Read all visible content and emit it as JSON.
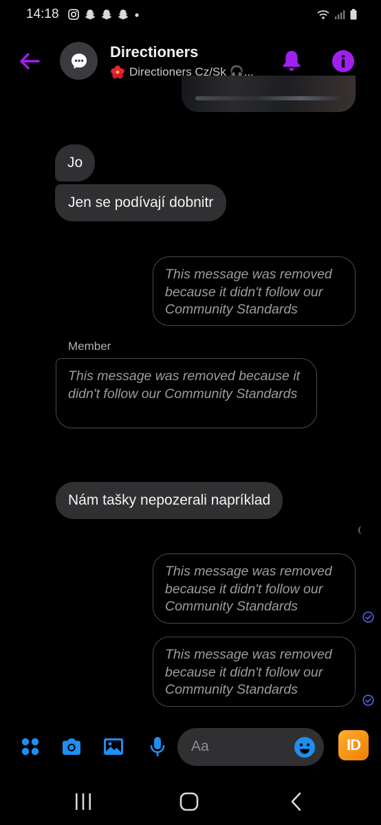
{
  "status_bar": {
    "time": "14:18"
  },
  "header": {
    "title": "Directioners",
    "subtitle": "Directioners Cz/Sk 🎧...",
    "accent_color": "#a020f0"
  },
  "messages": {
    "jo": "Jo",
    "jen": "Jen se podívají dobnitr",
    "removed_text": "This message was removed because it didn't follow our Community Standards",
    "removed_1": "This message was removed because it didn't follow our Community Standards",
    "sender_member": "Member",
    "removed_2": "This message was removed because it didn't follow our Community Standards",
    "nam": "Nám tašky nepozerali napríklad",
    "removed_3": "This message was removed because it didn't follow our Community Standards",
    "removed_4": "This message was removed because it didn't follow our Community Standards"
  },
  "composer": {
    "placeholder": "Aa",
    "app_badge": "ID",
    "icon_color": "#1d8ff2"
  },
  "icons": {
    "back": "arrow-left-icon",
    "avatar": "chat-bubble-icon",
    "bell": "bell-icon",
    "info": "info-icon",
    "apps": "four-dots-icon",
    "camera": "camera-icon",
    "gallery": "image-icon",
    "mic": "microphone-icon",
    "emoji": "smiley-icon"
  }
}
